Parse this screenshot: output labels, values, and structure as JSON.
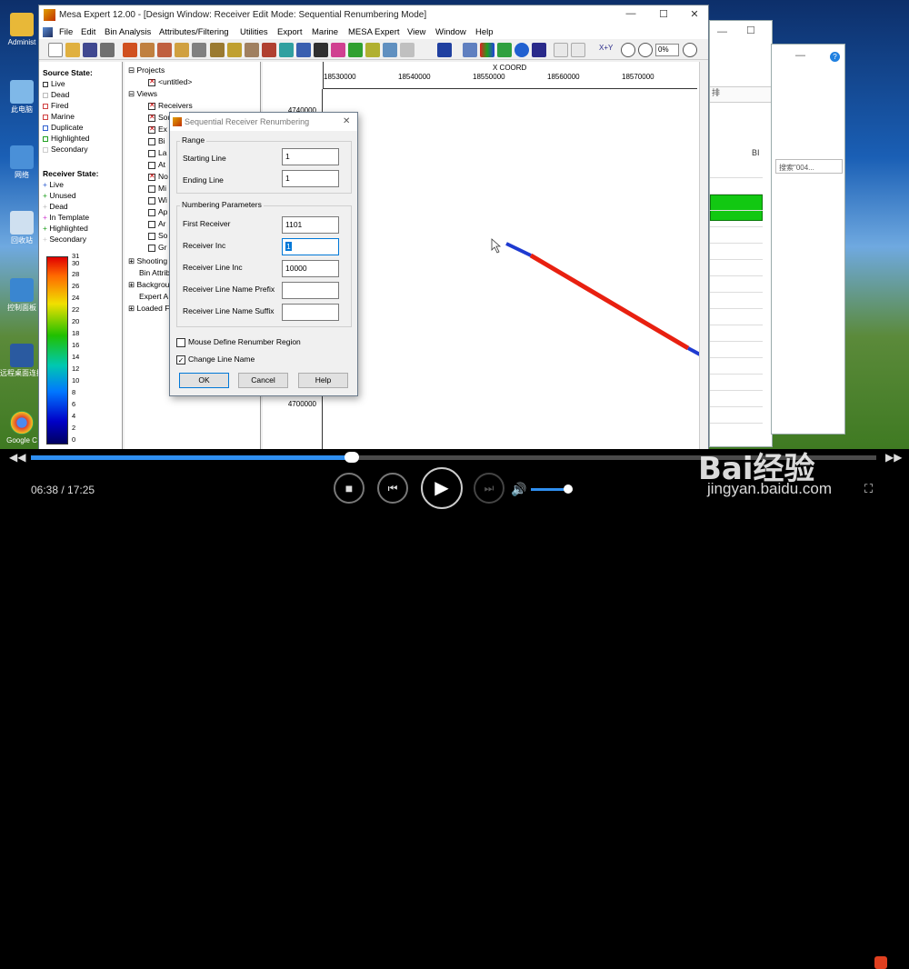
{
  "desktop": {
    "icons": [
      {
        "label": "Administ"
      },
      {
        "label": "此电脑"
      },
      {
        "label": "网络"
      },
      {
        "label": "回收站"
      },
      {
        "label": "控制面板"
      },
      {
        "label": "远程桌面连接"
      },
      {
        "label": "Google C"
      }
    ]
  },
  "window": {
    "title": "Mesa Expert 12.00 - [Design Window: Receiver Edit Mode: Sequential Renumbering Mode]",
    "minimize": "—",
    "maximize": "☐",
    "close": "✕"
  },
  "menu": [
    "File",
    "Edit",
    "Bin Analysis",
    "Attributes/Filtering",
    "Utilities",
    "Export",
    "Marine",
    "MESA Expert",
    "View",
    "Window",
    "Help"
  ],
  "toolbar": {
    "zoom_value": "0%",
    "xy_label": "X+Y"
  },
  "legend": {
    "source_title": "Source State:",
    "source_items": [
      {
        "label": "Live",
        "color": "#333333"
      },
      {
        "label": "Dead",
        "color": "#bbbbbb"
      },
      {
        "label": "Fired",
        "color": "#d04040"
      },
      {
        "label": "Marine",
        "color": "#d04040"
      },
      {
        "label": "Duplicate",
        "color": "#3060d0"
      },
      {
        "label": "Highlighted",
        "color": "#20a020"
      },
      {
        "label": "Secondary",
        "color": "#cccccc"
      }
    ],
    "receiver_title": "Receiver State:",
    "receiver_items": [
      {
        "label": "Live",
        "color": "#3060d0"
      },
      {
        "label": "Unused",
        "color": "#20a020"
      },
      {
        "label": "Dead",
        "color": "#bbbbbb"
      },
      {
        "label": "In Template",
        "color": "#d040d0"
      },
      {
        "label": "Highlighted",
        "color": "#20a020"
      },
      {
        "label": "Secondary",
        "color": "#cccccc"
      }
    ],
    "scale_ticks": [
      "31",
      "30",
      "28",
      "26",
      "24",
      "22",
      "20",
      "18",
      "16",
      "14",
      "12",
      "10",
      "8",
      "6",
      "4",
      "2",
      "0"
    ]
  },
  "tree": {
    "projects": "Projects",
    "untitled": "<untitled>",
    "views": "Views",
    "view_items": [
      "Receivers",
      "Sources",
      "Ex",
      "Bi",
      "La",
      "At",
      "No",
      "Mi",
      "Wi",
      "Ap",
      "Ar",
      "So",
      "Gr"
    ],
    "shooting": "Shooting",
    "bin_attrib": "Bin Attrib",
    "background": "Backgrou",
    "expert": "Expert A",
    "loaded": "Loaded F"
  },
  "plot": {
    "x_title": "X COORD",
    "x_ticks": [
      "18530000",
      "18540000",
      "18550000",
      "18560000",
      "18570000"
    ],
    "y_ticks": [
      "4740000",
      "4700000"
    ],
    "line_colors": {
      "live": "#1e3ad0",
      "selected": "#e82010"
    }
  },
  "dialog": {
    "title": "Sequential Receiver Renumbering",
    "close": "✕",
    "range_label": "Range",
    "starting_line_label": "Starting Line",
    "starting_line": "1",
    "ending_line_label": "Ending Line",
    "ending_line": "1",
    "numbering_label": "Numbering Parameters",
    "first_receiver_label": "First Receiver",
    "first_receiver": "1101",
    "receiver_inc_label": "Receiver Inc",
    "receiver_inc": "1",
    "receiver_line_inc_label": "Receiver Line Inc",
    "receiver_line_inc": "10000",
    "prefix_label": "Receiver Line Name Prefix",
    "prefix": "",
    "suffix_label": "Receiver Line Name Suffix",
    "suffix": "",
    "mouse_define_label": "Mouse Define Renumber Region",
    "mouse_define_checked": false,
    "change_line_name_label": "Change Line Name",
    "change_line_name_checked": true,
    "ok": "OK",
    "cancel": "Cancel",
    "help": "Help"
  },
  "background_window": {
    "search_placeholder": "搜索\"004...",
    "col_label": "BI",
    "partial_text": "排"
  },
  "player": {
    "time": "06:38 / 17:25",
    "progress": 0.38,
    "volume": 0.9
  },
  "watermark": {
    "brand": "Bai经验",
    "url": "jingyan.baidu.com"
  }
}
